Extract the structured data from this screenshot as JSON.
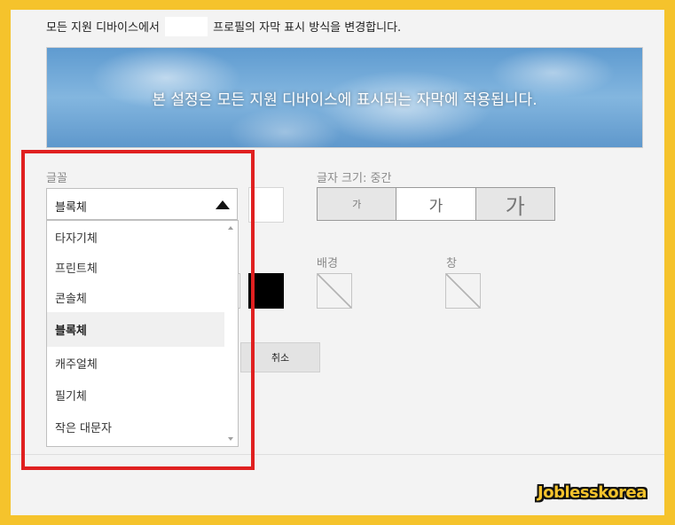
{
  "intro": {
    "before": "모든 지원 디바이스에서",
    "after": "프로필의 자막 표시 방식을 변경합니다."
  },
  "banner": {
    "text": "본 설정은 모든 지원 디바이스에 표시되는 자막에 적용됩니다."
  },
  "font": {
    "label": "글꼴",
    "selected": "블록체",
    "options": [
      "타자기체",
      "프린트체",
      "콘솔체",
      "블록체",
      "캐주얼체",
      "필기체",
      "작은 대문자"
    ],
    "selected_index": 3
  },
  "size": {
    "label": "글자 크기: 중간",
    "buttons": [
      {
        "label": "가",
        "value": "small"
      },
      {
        "label": "가",
        "value": "medium",
        "active": true
      },
      {
        "label": "가",
        "value": "large"
      }
    ]
  },
  "colors": {
    "text_swatch": "#000000",
    "background_label": "배경",
    "background_value": "none",
    "window_label": "창",
    "window_value": "none"
  },
  "actions": {
    "cancel_label": "취소"
  },
  "highlight_color": "#e02020",
  "watermark": {
    "text": "Joblesskorea"
  }
}
